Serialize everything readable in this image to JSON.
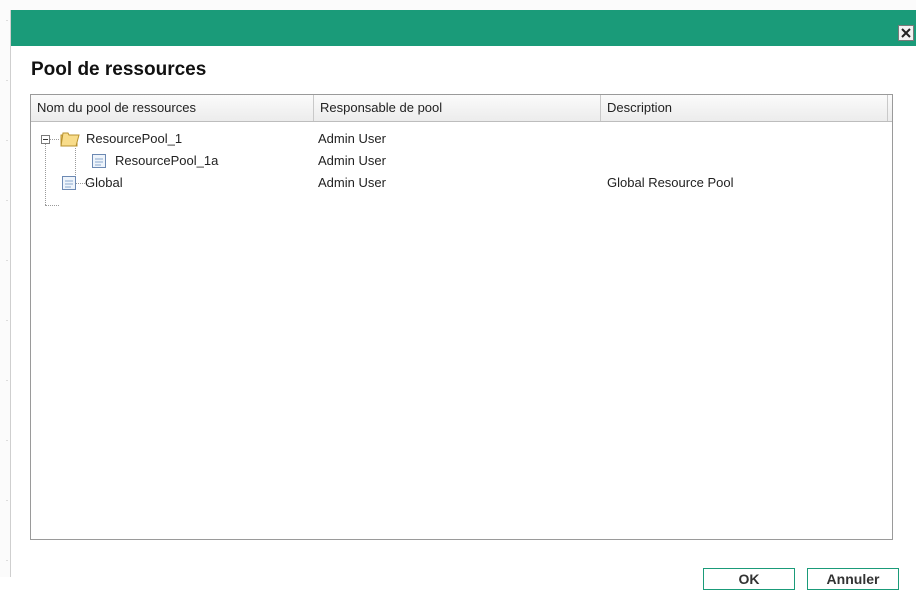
{
  "dialog": {
    "title": "Pool de ressources",
    "close_icon": "close-icon"
  },
  "grid": {
    "columns": [
      "Nom du pool de ressources",
      "Responsable de pool",
      "Description"
    ],
    "rows": [
      {
        "name": "ResourcePool_1",
        "owner": "Admin User",
        "description": "",
        "icon": "folder-icon",
        "level": 0,
        "expanded": true
      },
      {
        "name": "ResourcePool_1a",
        "owner": "Admin User",
        "description": "",
        "icon": "document-icon",
        "level": 1
      },
      {
        "name": "Global",
        "owner": "Admin User",
        "description": "Global Resource Pool",
        "icon": "document-icon",
        "level": 0
      }
    ]
  },
  "buttons": {
    "ok_label": "OK",
    "cancel_label": "Annuler"
  },
  "colors": {
    "title_bar": "#1a9b79",
    "folder": "#f1c45a"
  }
}
